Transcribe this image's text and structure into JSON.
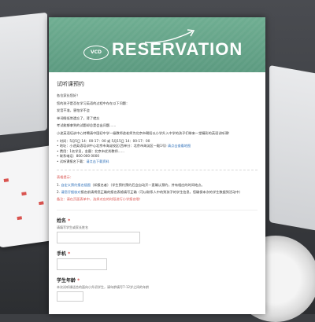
{
  "banner": {
    "logo_text": "VCD",
    "title": "RESERVATION"
  },
  "form": {
    "title": "试听课预约",
    "intro": [
      "各位家长您好！",
      "您的孩子是否在学习英语的过程中存在以下问题：",
      "发音不准，害怕学不会",
      "单词眼低常遗忘了，背了就忘",
      "考试能够拿到的试题却总是会出问题……",
      "小途英语培训中心特聘请中国初中学一级教师途老师为北京市朝阳以小学升入中学的孩子们带来一堂精彩的英语试听课！"
    ],
    "bullets": [
      {
        "text": "时间：5月5日 14：00-17：00 或 5月15日 14：00-17：00",
        "link": ""
      },
      {
        "text": "地址：小途英语培训中心北京市海淀校区(西单分：北京市海淀区一殿1号)",
        "link": "请点击查看地图"
      },
      {
        "text": "费用：1名学员，金额：北京市优秀教师……",
        "link": ""
      },
      {
        "text": "联系电话：800 000 0000",
        "link": ""
      },
      {
        "text": "试听课报名下载：",
        "link": "请点击下载资料"
      }
    ]
  },
  "notice": {
    "title": "表格提示：",
    "items": [
      {
        "prefix": "1. ",
        "link": "自定义预约报名插图",
        "mid": "（如报名者）（学生预约预约后会自动开一直确认预约，并有相应的时间地点。",
        "red": ""
      },
      {
        "prefix": "2. ",
        "link": "请您仔细核对",
        "mid": "报名前请将您正确的报名表格填写正确（可以联系人中的到孩子的学生信息，您确保本次的学生数据到活动中）",
        "red": ""
      },
      {
        "prefix": "",
        "link": "",
        "mid": "",
        "red": "备注：请在页面表单中，选择对应的时段进行小学报名哦！"
      }
    ]
  },
  "fields": [
    {
      "label": "姓名",
      "required": true,
      "hint": "请填写学生或家长姓名"
    },
    {
      "label": "手机",
      "required": true,
      "hint": ""
    },
    {
      "label": "学生年龄",
      "required": true,
      "hint": "本次试听课适合的面向小升初学生，请年龄填写7-12岁之间的年龄"
    }
  ],
  "colors": {
    "banner": "#6fae92",
    "link": "#2d6fb8",
    "required": "#d9534f"
  }
}
